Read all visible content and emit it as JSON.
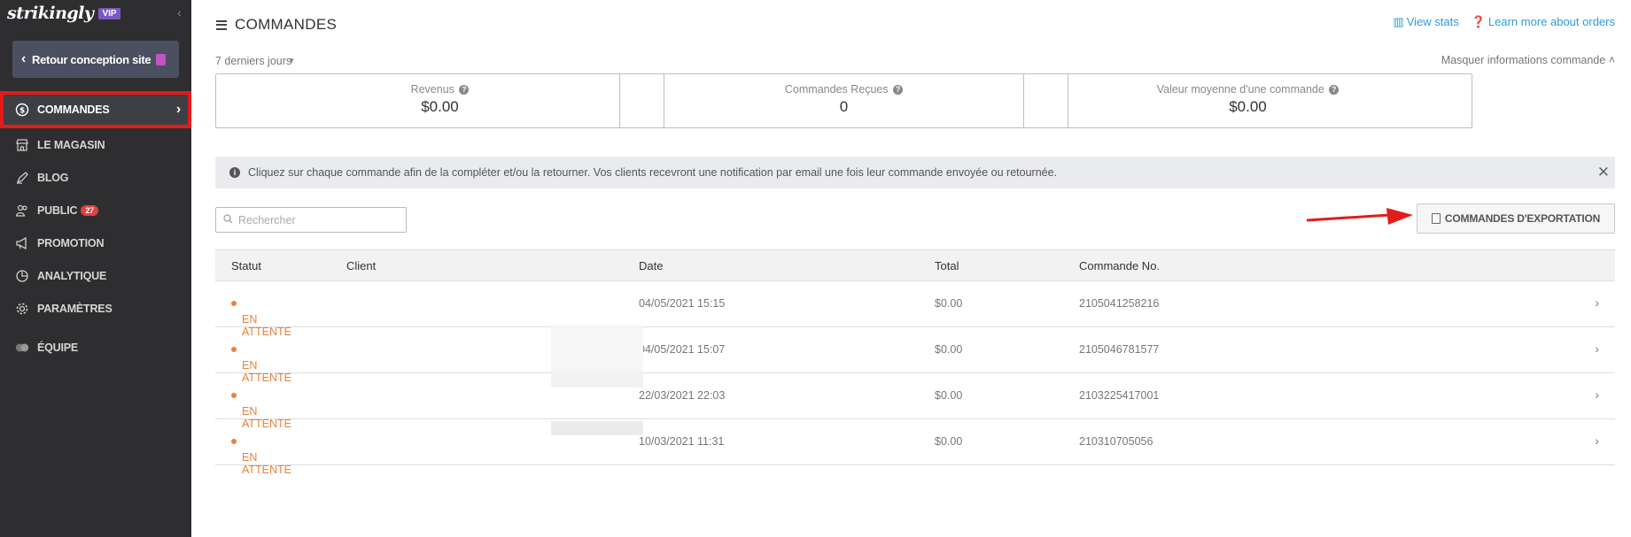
{
  "sidebar": {
    "logo": "strikingly",
    "vip_badge": "VIP",
    "back_button": "Retour conception site",
    "items": [
      {
        "label": "COMMANDES",
        "icon": "dollar-circle-icon",
        "active": true
      },
      {
        "label": "LE MAGASIN",
        "icon": "store-icon"
      },
      {
        "label": "BLOG",
        "icon": "pen-icon"
      },
      {
        "label": "PUBLIC",
        "icon": "people-icon",
        "badge": "27"
      },
      {
        "label": "PROMOTION",
        "icon": "megaphone-icon"
      },
      {
        "label": "ANALYTIQUE",
        "icon": "pie-chart-icon"
      },
      {
        "label": "PARAMÈTRES",
        "icon": "gear-icon"
      },
      {
        "label": "ÉQUIPE",
        "icon": "team-icon"
      }
    ]
  },
  "header": {
    "title": "COMMANDES",
    "view_stats": "View stats",
    "learn_more": "Learn more about orders"
  },
  "filters": {
    "period": "7 derniers jours",
    "hide_info": "Masquer informations commande"
  },
  "stats": [
    {
      "label": "Revenus",
      "value": "$0.00"
    },
    {
      "label": "Commandes Reçues",
      "value": "0"
    },
    {
      "label": "Valeur moyenne d'une commande",
      "value": "$0.00"
    }
  ],
  "notice": "Cliquez sur chaque commande afin de la compléter et/ou la retourner. Vos clients recevront une notification par email une fois leur commande envoyée ou retournée.",
  "search": {
    "placeholder": "Rechercher"
  },
  "export_button": "COMMANDES D'EXPORTATION",
  "table": {
    "columns": [
      "Statut",
      "Client",
      "Date",
      "Total",
      "Commande No."
    ],
    "rows": [
      {
        "status": "EN ATTENTE",
        "client": "",
        "date": "04/05/2021 15:15",
        "total": "$0.00",
        "order_no": "2105041258216"
      },
      {
        "status": "EN ATTENTE",
        "client": "",
        "date": "04/05/2021 15:07",
        "total": "$0.00",
        "order_no": "2105046781577"
      },
      {
        "status": "EN ATTENTE",
        "client": "",
        "date": "22/03/2021 22:03",
        "total": "$0.00",
        "order_no": "2103225417001"
      },
      {
        "status": "EN ATTENTE",
        "client": "",
        "date": "10/03/2021 11:31",
        "total": "$0.00",
        "order_no": "210310705056"
      }
    ]
  },
  "colors": {
    "sidebar_bg": "#2e2e30",
    "accent_link": "#2f9ad8",
    "status_pending": "#e8833a",
    "highlight_red": "#e41b1b"
  }
}
